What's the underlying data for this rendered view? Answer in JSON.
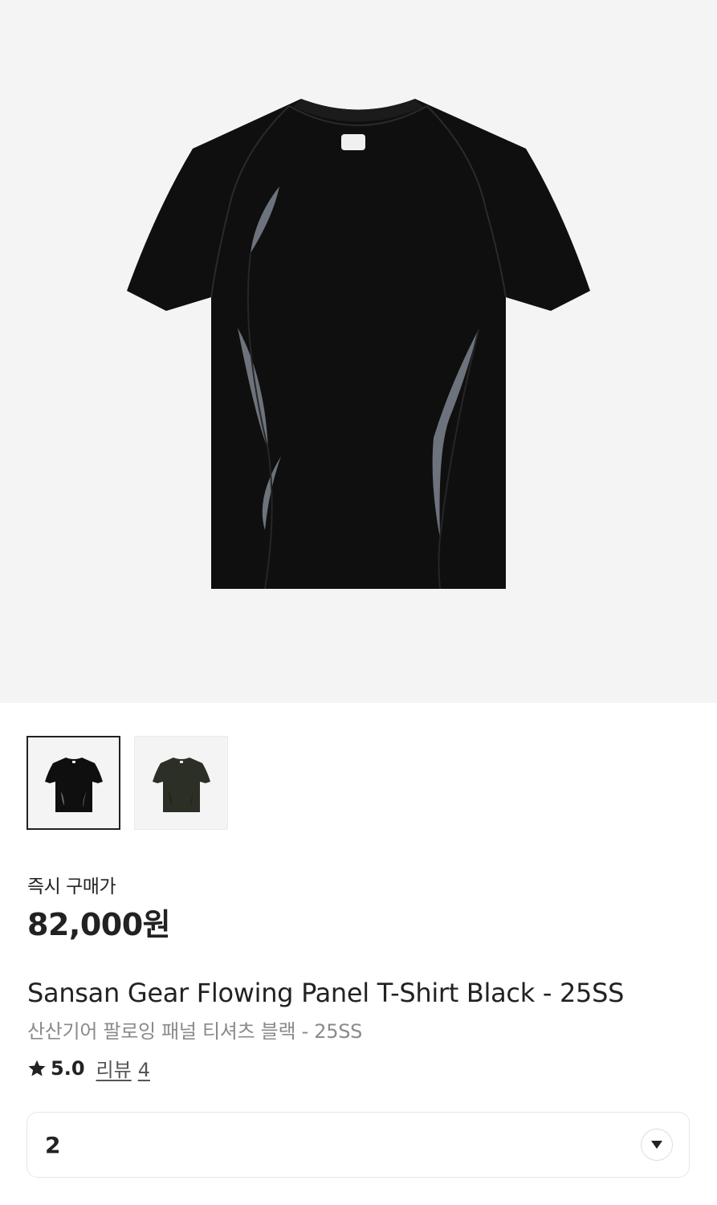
{
  "product": {
    "main_image": "black-tshirt-product-photo",
    "thumbnails": [
      {
        "color_name": "black",
        "fill": "#0f0f0f",
        "selected": true
      },
      {
        "color_name": "olive",
        "fill": "#2c2f25",
        "selected": false
      }
    ],
    "price_label": "즉시 구매가",
    "price": "82,000원",
    "title_en": "Sansan Gear Flowing Panel T-Shirt Black - 25SS",
    "title_ko": "산산기어 팔로잉 패널 티셔츠 블랙 - 25SS",
    "rating": "5.0",
    "review_label": "리뷰",
    "review_count": "4"
  },
  "size_select": {
    "value": "2",
    "icon": "chevron-down-icon"
  },
  "colors": {
    "hero_background": "#f4f4f4",
    "shirt_black": "#0f0f0f",
    "panel_gray": "#6d737c",
    "text_primary": "#222222",
    "text_secondary": "#8a8a8a"
  }
}
